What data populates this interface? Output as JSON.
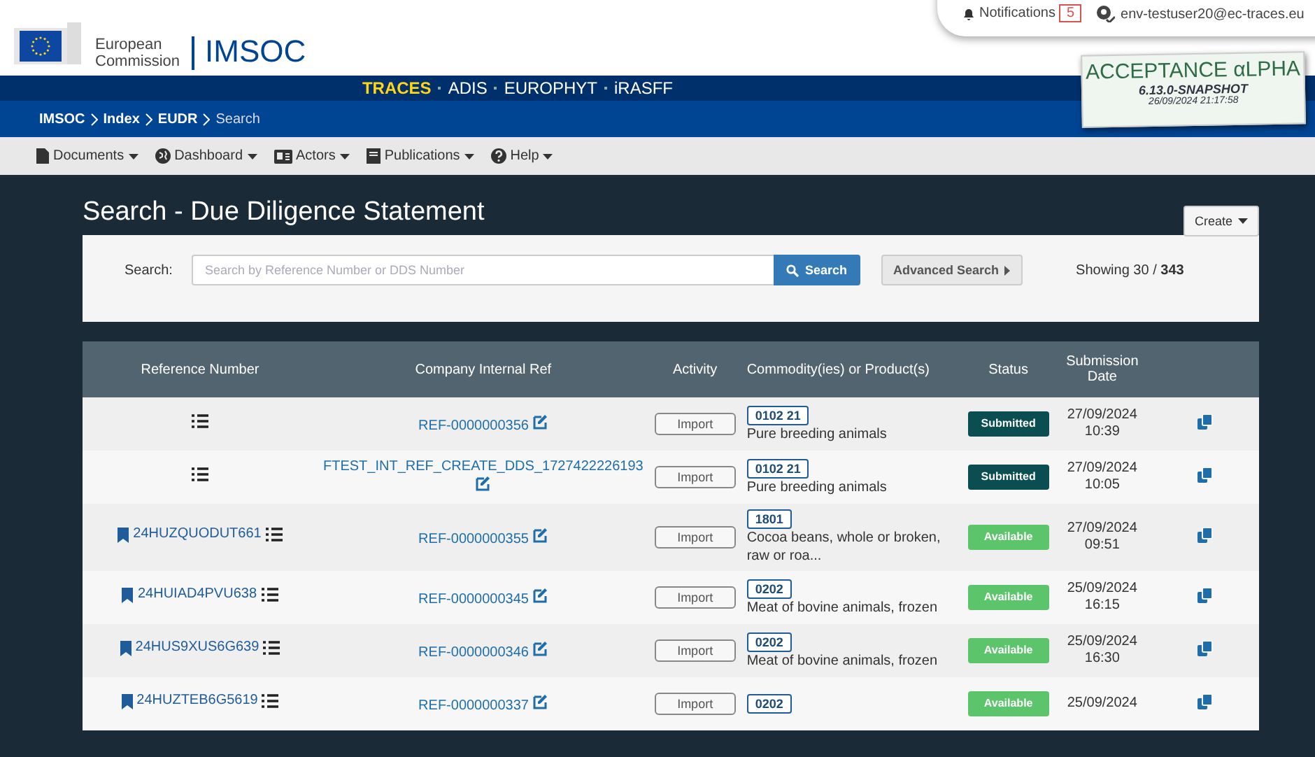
{
  "header": {
    "org_line1": "European",
    "org_line2": "Commission",
    "app_name": "IMSOC"
  },
  "user_bar": {
    "notifications_label": "Notifications",
    "notifications_count": "5",
    "user": "env-testuser20@ec-traces.eu"
  },
  "environment": {
    "name": "ACCEPTANCE αLPHA",
    "version": "6.13.0-SNAPSHOT",
    "timestamp": "26/09/2024 21:17:58"
  },
  "systems": [
    {
      "label": "TRACES",
      "selected": true
    },
    {
      "label": "ADIS",
      "selected": false
    },
    {
      "label": "EUROPHYT",
      "selected": false
    },
    {
      "label": "iRASFF",
      "selected": false
    }
  ],
  "breadcrumb": [
    {
      "label": "IMSOC",
      "current": false
    },
    {
      "label": "Index",
      "current": false
    },
    {
      "label": "EUDR",
      "current": false
    },
    {
      "label": "Search",
      "current": true
    }
  ],
  "menu": [
    {
      "label": "Documents"
    },
    {
      "label": "Dashboard"
    },
    {
      "label": "Actors"
    },
    {
      "label": "Publications"
    },
    {
      "label": "Help"
    }
  ],
  "page_title": "Search - Due Diligence Statement",
  "create_button": "Create",
  "search": {
    "label": "Search:",
    "placeholder": "Search by Reference Number or DDS Number",
    "button": "Search",
    "advanced": "Advanced Search",
    "showing": "Showing 30 / ",
    "total": "343"
  },
  "table": {
    "columns": [
      "Reference Number",
      "Company Internal Ref",
      "Activity",
      "Commodity(ies) or Product(s)",
      "Status",
      "Submission Date"
    ],
    "rows": [
      {
        "reference": "",
        "company_ref": "REF-0000000356",
        "activity": "Import",
        "code": "0102 21",
        "description": "Pure breeding animals",
        "status": "Submitted",
        "date": "27/09/2024",
        "time": "10:39"
      },
      {
        "reference": "",
        "company_ref": "FTEST_INT_REF_CREATE_DDS_1727422226193",
        "activity": "Import",
        "code": "0102 21",
        "description": "Pure breeding animals",
        "status": "Submitted",
        "date": "27/09/2024",
        "time": "10:05"
      },
      {
        "reference": "24HUZQUODUT661",
        "company_ref": "REF-0000000355",
        "activity": "Import",
        "code": "1801",
        "description": "Cocoa beans, whole or broken, raw or roa...",
        "status": "Available",
        "date": "27/09/2024",
        "time": "09:51"
      },
      {
        "reference": "24HUIAD4PVU638",
        "company_ref": "REF-0000000345",
        "activity": "Import",
        "code": "0202",
        "description": "Meat of bovine animals, frozen",
        "status": "Available",
        "date": "25/09/2024",
        "time": "16:15"
      },
      {
        "reference": "24HUS9XUS6G639",
        "company_ref": "REF-0000000346",
        "activity": "Import",
        "code": "0202",
        "description": "Meat of bovine animals, frozen",
        "status": "Available",
        "date": "25/09/2024",
        "time": "16:30"
      },
      {
        "reference": "24HUZTEB6G5619",
        "company_ref": "REF-0000000337",
        "activity": "Import",
        "code": "0202",
        "status": "Available",
        "date": "25/09/2024"
      }
    ]
  }
}
